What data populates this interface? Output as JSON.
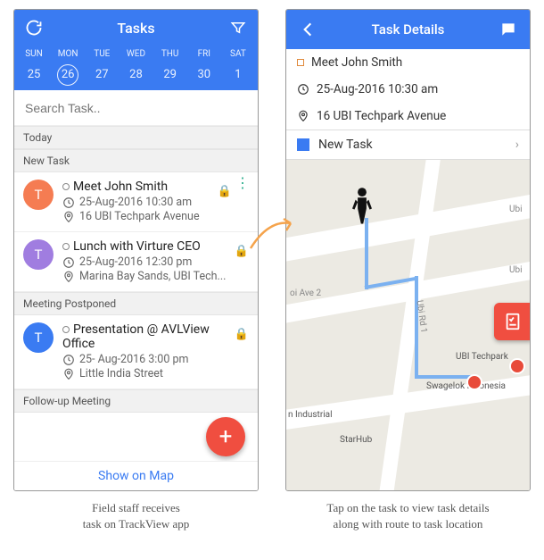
{
  "left": {
    "title": "Tasks",
    "days_labels": [
      "SUN",
      "MON",
      "TUE",
      "WED",
      "THU",
      "FRI",
      "SAT"
    ],
    "days_nums": [
      "25",
      "26",
      "27",
      "28",
      "29",
      "30",
      "1"
    ],
    "selected_index": 1,
    "search_placeholder": "Search Task..",
    "sections": {
      "today": "Today",
      "new_task": "New Task",
      "meeting_postponed": "Meeting Postponed",
      "followup": "Follow-up Meeting"
    },
    "tasks": [
      {
        "avatar": "T",
        "color": "orange",
        "title": "Meet John Smith",
        "time": "25-Aug-2016 10:30 am",
        "loc": "16 UBI Techpark Avenue",
        "menu": true
      },
      {
        "avatar": "T",
        "color": "purple",
        "title": "Lunch with Virture CEO",
        "time": "25-Aug-2016 12:30 pm",
        "loc": "Marina Bay Sands, UBI Tech...",
        "menu": false
      },
      {
        "avatar": "T",
        "color": "blue",
        "title": "Presentation @ AVLView Office",
        "time": "25- Aug-2016 3:00 pm",
        "loc": "Little India Street",
        "menu": false
      }
    ],
    "show_on_map": "Show on Map"
  },
  "right": {
    "title": "Task Details",
    "task_title": "Meet John Smith",
    "time": "25-Aug-2016 10:30 am",
    "loc": "16 UBI Techpark Avenue",
    "status": "New Task",
    "map_labels": {
      "oi_ave2": "oi Ave 2",
      "ubi_rd1": "Ubi Rd 1",
      "ubi1": "Ubi",
      "ubi2": "Ubi",
      "place1": "UBI Techpark",
      "place2": "Swagelok Indonesia",
      "place3": "StarHub",
      "place4": "n Industrial"
    }
  },
  "captions": {
    "left_l1": "Field staff receives",
    "left_l2": "task on TrackView app",
    "right_l1": "Tap on the task to view task details",
    "right_l2": "along with route to task location"
  }
}
